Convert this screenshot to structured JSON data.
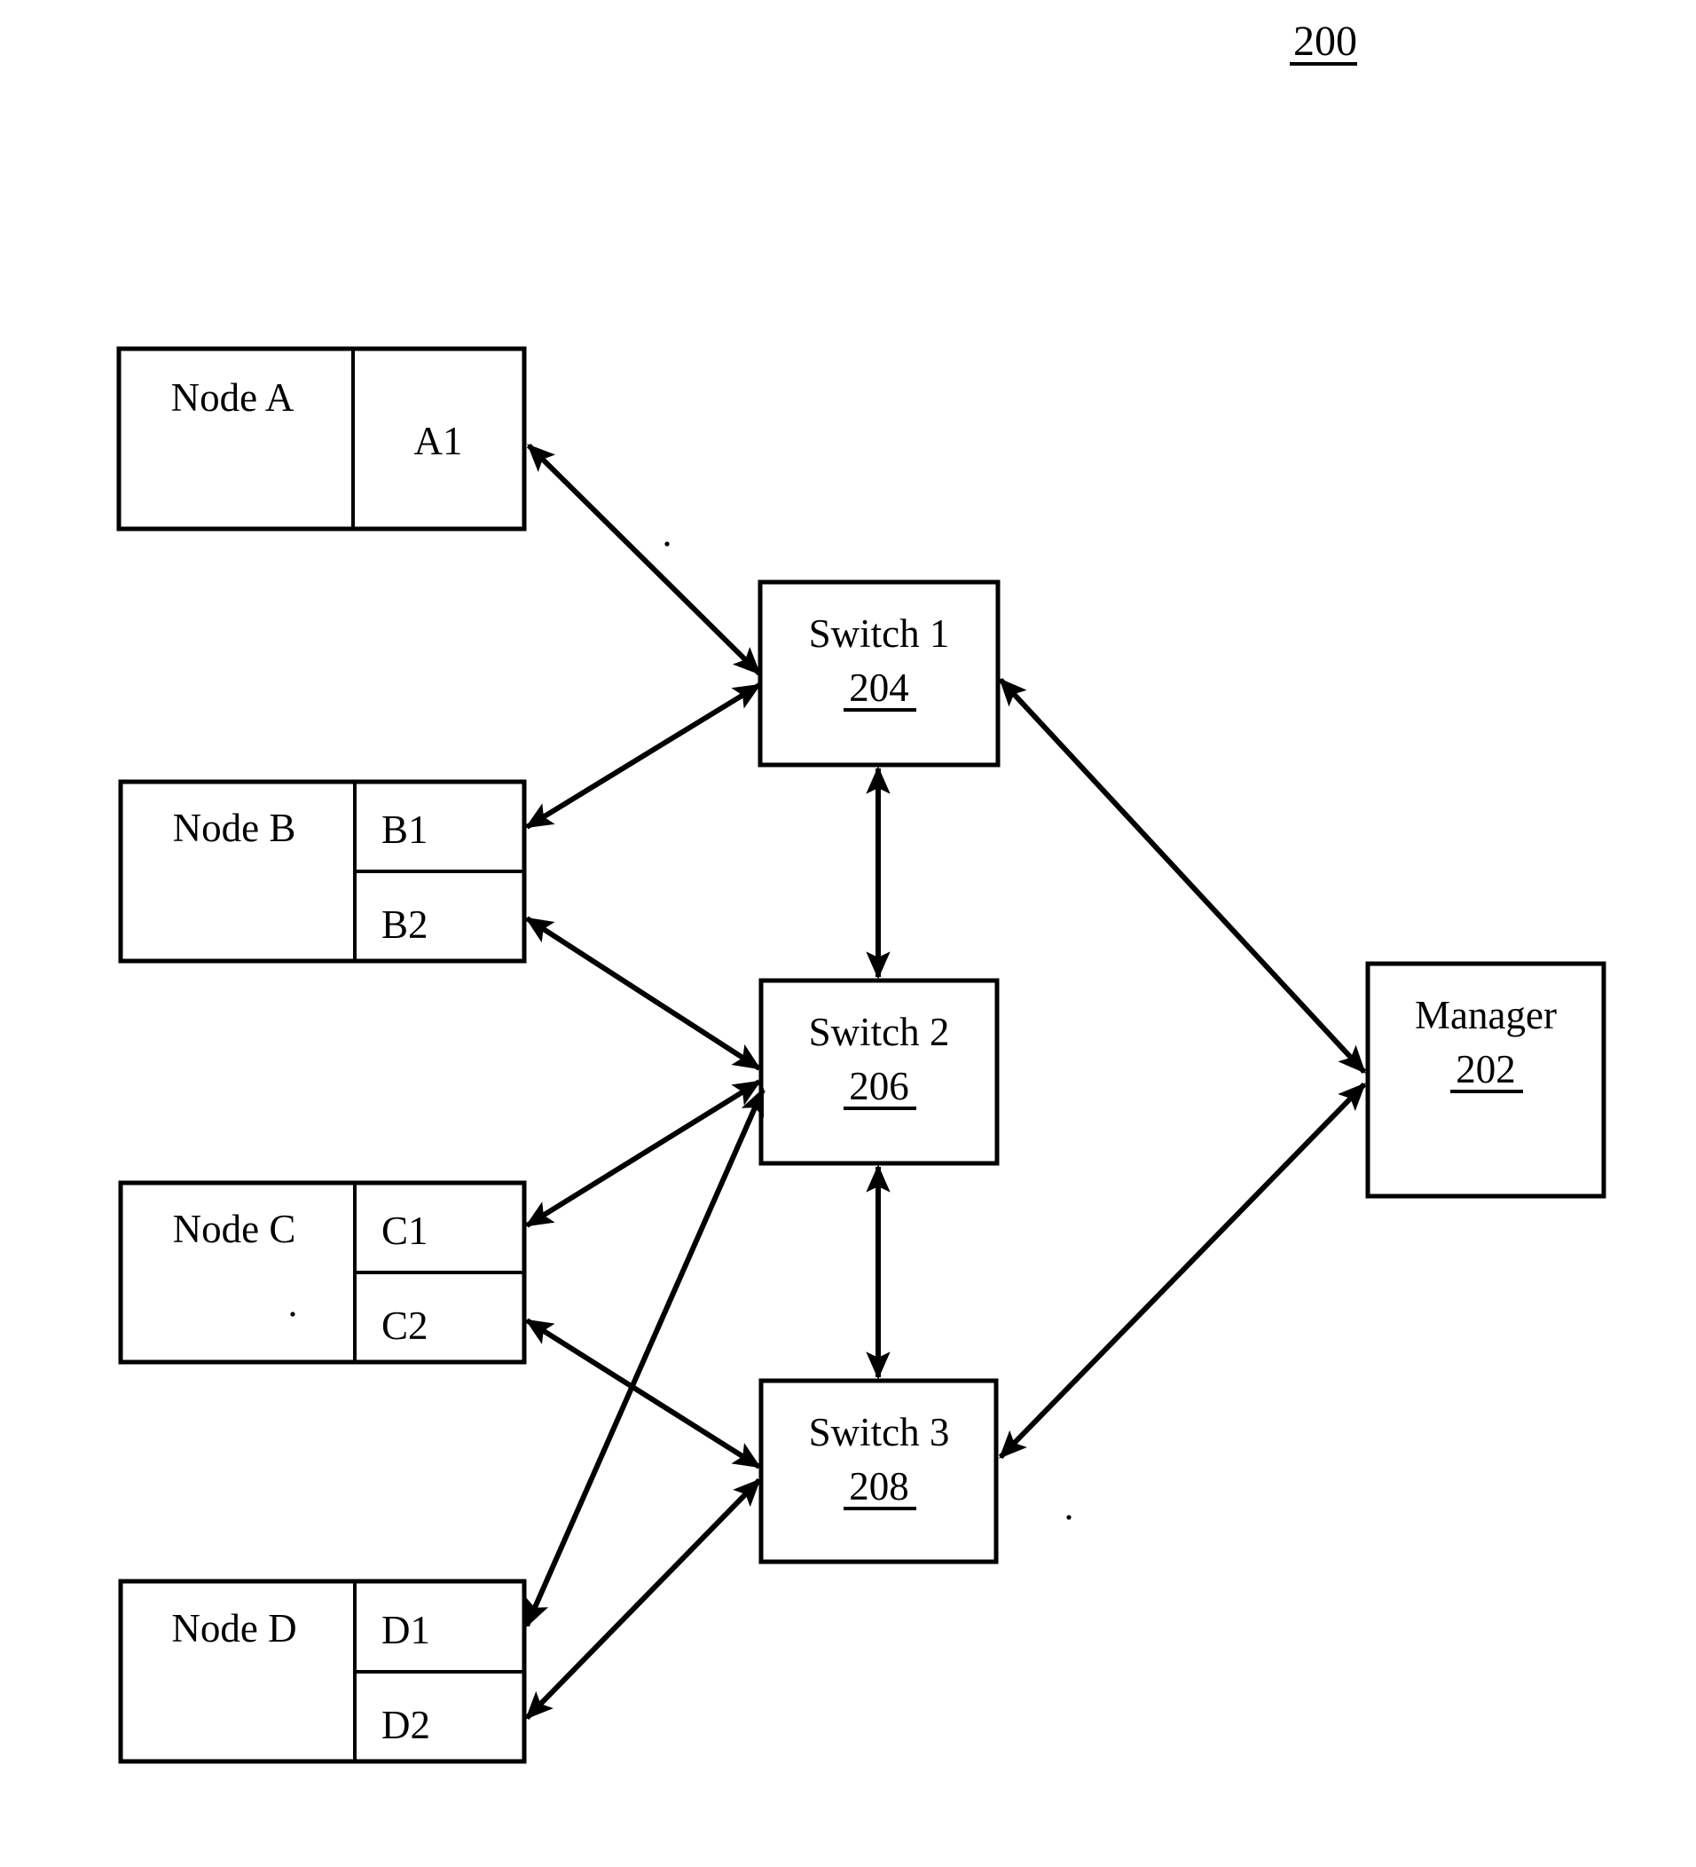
{
  "figure": {
    "number": "200",
    "number_underlined": true,
    "background_color": "#ffffff",
    "line_color": "#000000"
  },
  "nodes": [
    {
      "id": "node-a",
      "name": "Node A",
      "ports": [
        "A1"
      ]
    },
    {
      "id": "node-b",
      "name": "Node B",
      "ports": [
        "B1",
        "B2"
      ]
    },
    {
      "id": "node-c",
      "name": "Node C",
      "ports": [
        "C1",
        "C2"
      ]
    },
    {
      "id": "node-d",
      "name": "Node D",
      "ports": [
        "D1",
        "D2"
      ]
    }
  ],
  "switches": [
    {
      "id": "switch-1",
      "title": "Switch 1",
      "ref": "204"
    },
    {
      "id": "switch-2",
      "title": "Switch 2",
      "ref": "206"
    },
    {
      "id": "switch-3",
      "title": "Switch 3",
      "ref": "208"
    }
  ],
  "manager": {
    "id": "manager",
    "title": "Manager",
    "ref": "202"
  },
  "connections": [
    {
      "from": "A1",
      "to": "Switch 1",
      "arrows": "both"
    },
    {
      "from": "B1",
      "to": "Switch 1",
      "arrows": "both"
    },
    {
      "from": "B2",
      "to": "Switch 2",
      "arrows": "both"
    },
    {
      "from": "C1",
      "to": "Switch 2",
      "arrows": "both"
    },
    {
      "from": "C2",
      "to": "Switch 3",
      "arrows": "both"
    },
    {
      "from": "D1",
      "to": "Switch 2",
      "arrows": "both"
    },
    {
      "from": "D2",
      "to": "Switch 3",
      "arrows": "both"
    },
    {
      "from": "Switch 1",
      "to": "Switch 2",
      "arrows": "both"
    },
    {
      "from": "Switch 2",
      "to": "Switch 3",
      "arrows": "both"
    },
    {
      "from": "Switch 1",
      "to": "Manager",
      "arrows": "both"
    },
    {
      "from": "Switch 3",
      "to": "Manager",
      "arrows": "both"
    }
  ]
}
